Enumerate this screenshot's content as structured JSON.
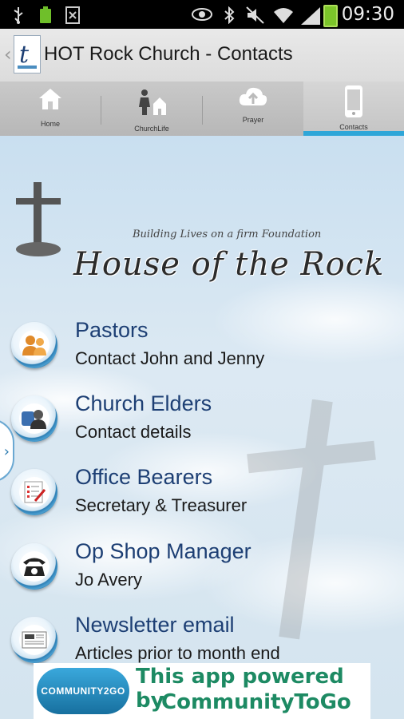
{
  "status_bar": {
    "time": "09:30",
    "icons": [
      "usb-icon",
      "battery-full-icon",
      "screenshot-icon",
      "eye-icon",
      "bluetooth-icon",
      "mute-icon",
      "wifi-icon",
      "signal-icon",
      "battery-icon"
    ]
  },
  "action_bar": {
    "title": "HOT Rock Church - Contacts",
    "back_glyph": "‹"
  },
  "tabs": [
    {
      "label": "Home",
      "icon": "house-icon",
      "selected": false
    },
    {
      "label": "ChurchLife",
      "icon": "churchlife-icon",
      "selected": false
    },
    {
      "label": "Prayer",
      "icon": "cloud-upload-icon",
      "selected": false
    },
    {
      "label": "Contacts",
      "icon": "phone-icon",
      "selected": true
    }
  ],
  "banner": {
    "tagline": "Building Lives on a firm Foundation",
    "name": "House of the Rock"
  },
  "contacts": [
    {
      "title": "Pastors",
      "subtitle": "Contact John and Jenny",
      "icon": "people-icon"
    },
    {
      "title": "Church Elders",
      "subtitle": "Contact details",
      "icon": "group-icon"
    },
    {
      "title": "Office Bearers",
      "subtitle": "Secretary & Treasurer",
      "icon": "checklist-icon"
    },
    {
      "title": "Op Shop Manager",
      "subtitle": "Jo Avery",
      "icon": "telephone-icon"
    },
    {
      "title": "Newsletter email",
      "subtitle": "Articles prior to month end",
      "icon": "newspaper-icon"
    }
  ],
  "drawer_handle": "›",
  "ad": {
    "logo": "COMMUNITY2GO",
    "line1": "This app powered by",
    "line2": "CommunityToGo"
  },
  "colors": {
    "accent": "#2ea6d8",
    "title_blue": "#1d3f74",
    "ad_green": "#1d8a63"
  }
}
